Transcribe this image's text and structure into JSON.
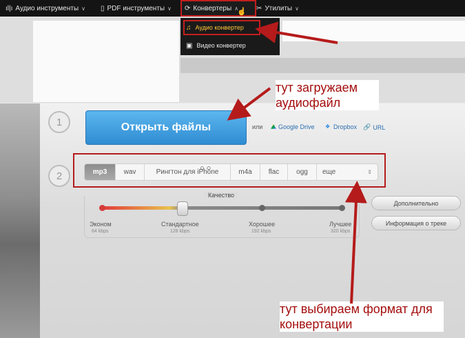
{
  "topnav": {
    "items": [
      {
        "icon": "waveform-icon",
        "label": "Аудио инструменты"
      },
      {
        "icon": "pdf-icon",
        "label": "PDF инструменты"
      },
      {
        "icon": "convert-icon",
        "label": "Конвертеры"
      },
      {
        "icon": "tools-icon",
        "label": "Утилиты"
      }
    ]
  },
  "dropdown": {
    "items": [
      {
        "icon": "music-note-icon",
        "label": "Аудио конвертер"
      },
      {
        "icon": "video-icon",
        "label": "Видео конвертер"
      }
    ]
  },
  "steps": {
    "one": "1",
    "two": "2"
  },
  "upload": {
    "open_label": "Открыть файлы",
    "or": "или",
    "sources": [
      "Google Drive",
      "Dropbox",
      "URL"
    ]
  },
  "formats": {
    "items": [
      "mp3",
      "wav",
      "Рингтон для iPhone",
      "m4a",
      "flac",
      "ogg",
      "еще"
    ],
    "selected": "mp3"
  },
  "quality": {
    "title": "Качество",
    "levels": [
      {
        "label": "Эконом",
        "kbps": "64 kbps"
      },
      {
        "label": "Стандартное",
        "kbps": "128 kbps"
      },
      {
        "label": "Хорошее",
        "kbps": "192 kbps"
      },
      {
        "label": "Лучшее",
        "kbps": "320 kbps"
      }
    ],
    "selected_level": "Стандартное"
  },
  "side_buttons": {
    "advanced": "Дополнительно",
    "track_info": "Информация о треке"
  },
  "annotations": {
    "upload_note": "тут загружаем аудиофайл",
    "format_note": "тут выбираем формат для конвертации"
  },
  "colors": {
    "accent": "#2f8cd2",
    "annotation": "#b51b1b",
    "highlight": "#ffc43a"
  }
}
